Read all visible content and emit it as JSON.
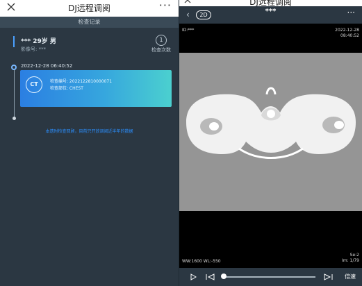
{
  "left": {
    "title": "DJ远程调阅",
    "more": "···",
    "section_title": "检查记录",
    "patient_line": "***   29岁   男",
    "image_no": "影像号:  ***",
    "visit_count": "1",
    "visit_count_label": "检查次数",
    "exam_datetime": "2022-12-28 06:40:52",
    "card": {
      "modality": "CT",
      "exam_no": "检查编号:  2022122810000071",
      "body_part": "检查部位:  CHEST"
    },
    "notice": "本遗时检查回顾，目前只开放调阅近半年的数据"
  },
  "right": {
    "title": "DJ远程调阅",
    "view_mode": "2D",
    "patient_id": "***",
    "more": "···",
    "overlay": {
      "top_left": "ID:***",
      "top_right_date": "2022-12-28",
      "top_right_time": "08:40:52",
      "bottom_left": "WW:1600 WL:-550",
      "bottom_right_series": "Se:2",
      "bottom_right_image": "Im: 1/79"
    },
    "player": {
      "speed_label": "倍速",
      "progress": 0.0
    }
  },
  "colors": {
    "accent": "#4aa0ff",
    "card_start": "#2b7fe2",
    "card_end": "#4bd0cf"
  }
}
